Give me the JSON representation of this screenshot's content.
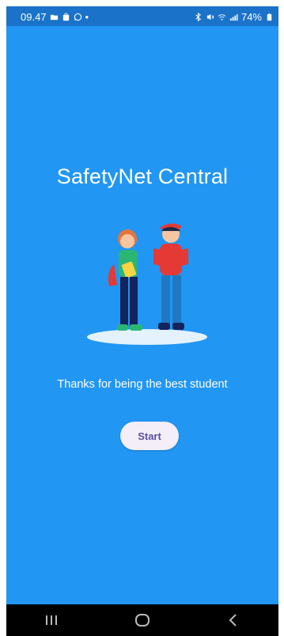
{
  "status_bar": {
    "time": "09.47",
    "battery": "74%",
    "dot": "•",
    "icons": [
      "folder-icon",
      "shop-icon",
      "whatsapp-icon",
      "bluetooth-icon",
      "mute-icon",
      "wifi-icon",
      "signal-icon",
      "battery-icon"
    ]
  },
  "app": {
    "title": "SafetyNet Central",
    "subtitle": "Thanks for being the best student",
    "start_label": "Start"
  },
  "colors": {
    "background": "#2196F3",
    "status_bar": "#1A73C9",
    "button_bg": "#F3EEF7",
    "button_text": "#5E4FA1"
  },
  "nav_bar": {
    "buttons": [
      "recent-apps-icon",
      "home-icon",
      "back-icon"
    ]
  }
}
